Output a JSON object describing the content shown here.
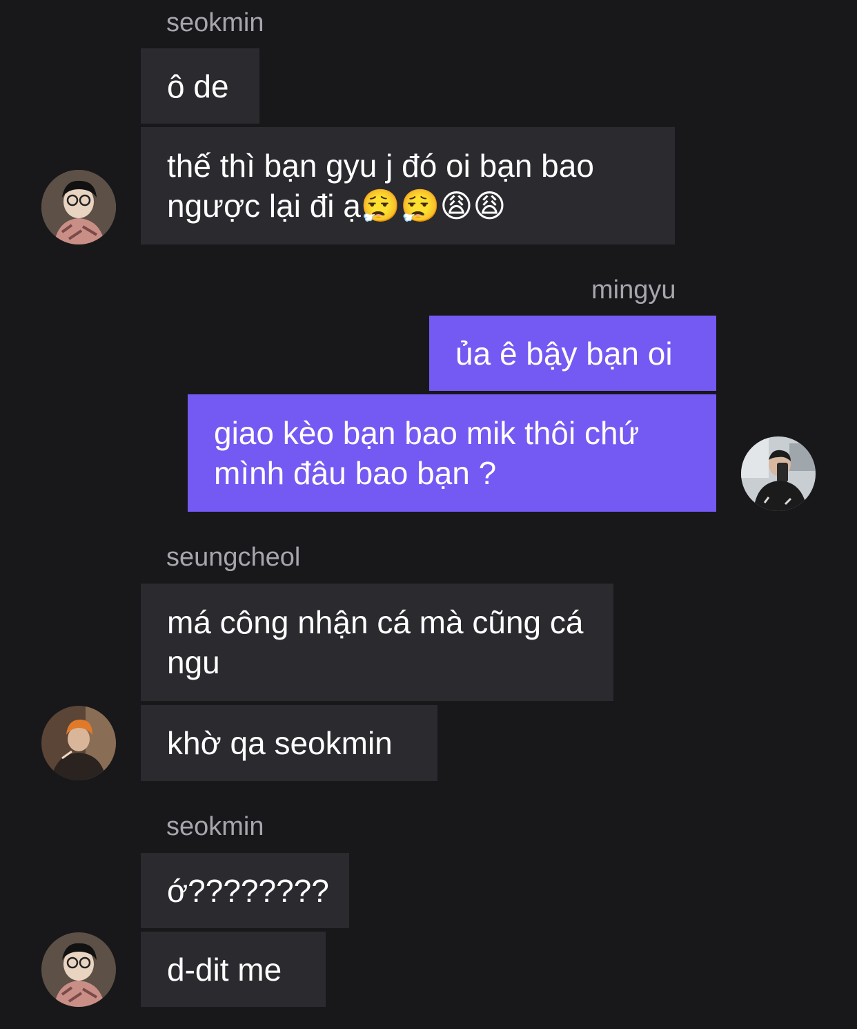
{
  "chat": {
    "groups": [
      {
        "sender": "seokmin",
        "messages": [
          "ô de",
          "thế thì bạn gyu j đó oi bạn bao ngược lại đi ạ😮‍💨😮‍💨😩😩"
        ],
        "avatar_icon": "seokmin-avatar"
      },
      {
        "sender": "mingyu",
        "messages": [
          "ủa ê bậy bạn oi",
          "giao kèo bạn bao mik thôi chứ mình đâu bao bạn ?"
        ],
        "avatar_icon": "mingyu-avatar"
      },
      {
        "sender": "seungcheol",
        "messages": [
          "má công nhận cá mà cũng cá ngu",
          "khờ qa seokmin"
        ],
        "avatar_icon": "seungcheol-avatar"
      },
      {
        "sender": "seokmin",
        "messages": [
          "ớ????????",
          "d-dit me"
        ],
        "avatar_icon": "seokmin-avatar"
      }
    ]
  },
  "colors": {
    "background": "#18181b",
    "incoming_bubble": "#2b2b2f",
    "outgoing_bubble": "#7559f3",
    "sender_name": "#a6a6ad"
  }
}
